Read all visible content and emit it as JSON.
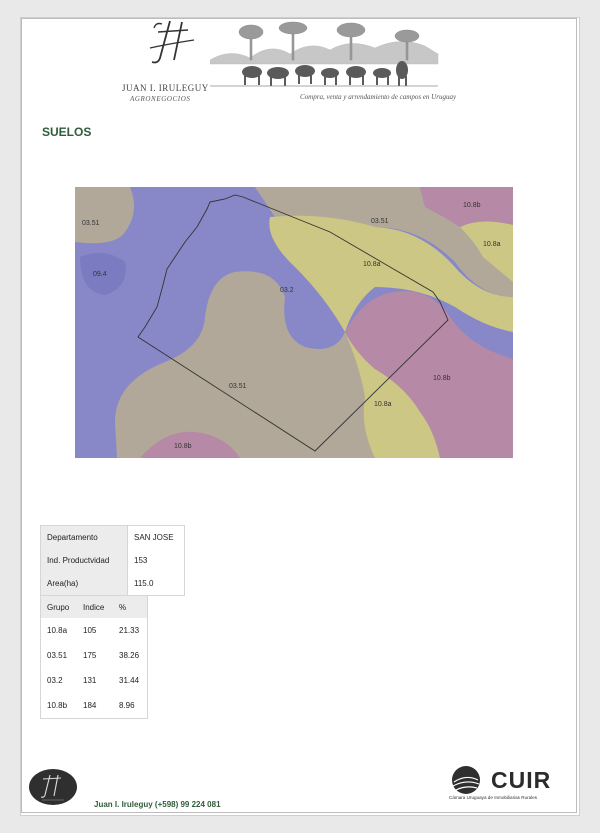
{
  "header": {
    "brand_name": "JUAN I. IRULEGUY",
    "brand_sub": "AGRONEGOCIOS",
    "tagline": "Compra, venta y arrendamiento de campos en Uruguay"
  },
  "section": {
    "title": "SUELOS"
  },
  "map": {
    "labels": [
      "10.8b",
      "03.51",
      "10.8a",
      "03.51",
      "09.4",
      "10.8a",
      "03.2",
      "03.51",
      "10.8b",
      "10.8a",
      "10.8b"
    ],
    "colors": {
      "purple": "#8888c8",
      "beige": "#b2a89a",
      "yellow": "#cdc785",
      "magenta": "#b68aa6",
      "boundary": "#333333"
    }
  },
  "info": {
    "rows": [
      {
        "label": "Departamento",
        "value": "SAN JOSE"
      },
      {
        "label": "Ind. Productvidad",
        "value": "153"
      },
      {
        "label": "Area(ha)",
        "value": "115.0"
      }
    ]
  },
  "soils": {
    "headers": [
      "Grupo",
      "Indice",
      "%"
    ],
    "rows": [
      [
        "10.8a",
        "105",
        "21.33"
      ],
      [
        "03.51",
        "175",
        "38.26"
      ],
      [
        "03.2",
        "131",
        "31.44"
      ],
      [
        "10.8b",
        "184",
        "8.96"
      ]
    ]
  },
  "footer": {
    "contact": "Juan I. Iruleguy (+598) 99 224 081",
    "cuir_name": "CUIR",
    "cuir_sub": "Cámara Uruguaya de Inmobiliarias Rurales"
  }
}
